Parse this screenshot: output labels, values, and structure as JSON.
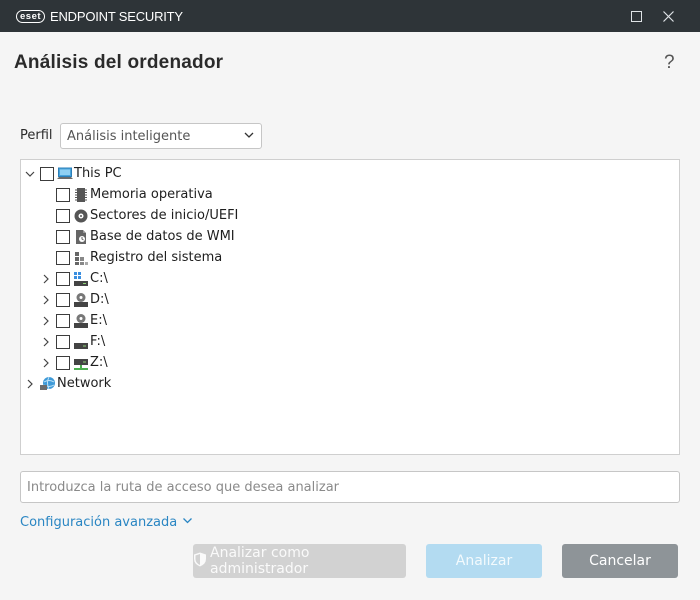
{
  "window": {
    "logo_text": "eset",
    "product_name": "ENDPOINT SECURITY"
  },
  "header": {
    "title": "Análisis del ordenador",
    "help": "?"
  },
  "profile": {
    "label": "Perfil",
    "selected": "Análisis inteligente"
  },
  "tree": {
    "items": [
      {
        "label": "This PC",
        "icon": "computer-icon",
        "expanded": true
      },
      {
        "label": "Memoria operativa",
        "icon": "memory-chip-icon"
      },
      {
        "label": "Sectores de inicio/UEFI",
        "icon": "boot-disc-icon"
      },
      {
        "label": "Base de datos de WMI",
        "icon": "wmi-database-icon"
      },
      {
        "label": "Registro del sistema",
        "icon": "registry-icon"
      },
      {
        "label": "C:\\",
        "icon": "system-drive-icon"
      },
      {
        "label": "D:\\",
        "icon": "optical-drive-icon"
      },
      {
        "label": "E:\\",
        "icon": "optical-drive-icon"
      },
      {
        "label": "F:\\",
        "icon": "drive-icon"
      },
      {
        "label": "Z:\\",
        "icon": "network-drive-icon"
      },
      {
        "label": "Network",
        "icon": "network-icon"
      }
    ]
  },
  "path": {
    "placeholder": "Introduzca la ruta de acceso que desea analizar"
  },
  "advanced": {
    "label": "Configuración avanzada"
  },
  "buttons": {
    "scan_admin": "Analizar como administrador",
    "scan": "Analizar",
    "cancel": "Cancelar"
  },
  "colors": {
    "titlebar": "#2e3438",
    "link": "#2a86c3",
    "primary_disabled": "#b3dbf1",
    "cancel": "#8e9498"
  }
}
